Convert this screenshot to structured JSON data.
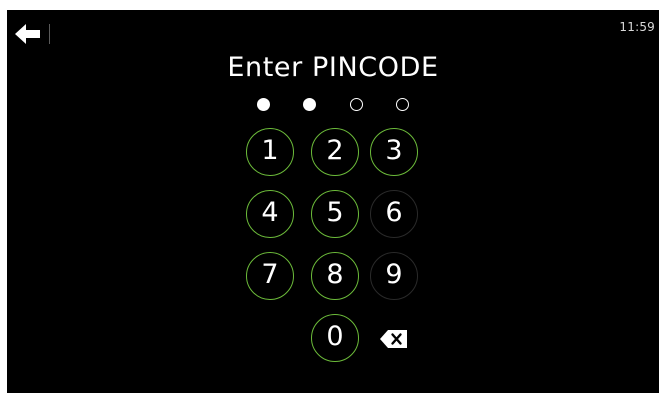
{
  "status_bar": {
    "back_icon": "arrow-left-icon",
    "time": "11:59"
  },
  "pin_entry": {
    "title": "Enter PINCODE",
    "digits_total": 4,
    "digits_entered": 2
  },
  "keypad": {
    "keys": [
      "1",
      "2",
      "3",
      "4",
      "5",
      "6",
      "7",
      "8",
      "9",
      "0"
    ],
    "delete_icon": "backspace-icon",
    "accent_color": "#6cbb3a"
  }
}
